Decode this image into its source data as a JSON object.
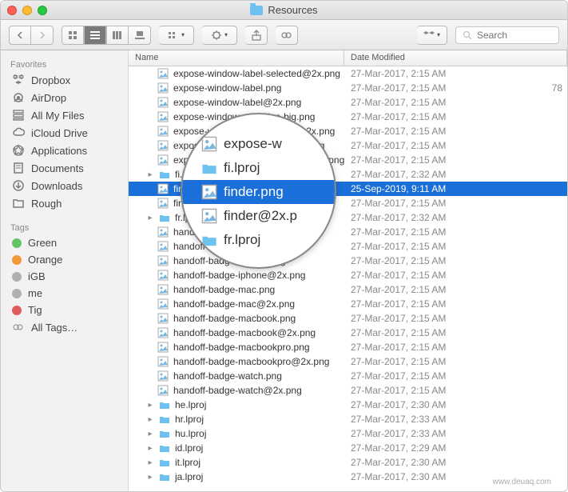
{
  "window": {
    "title": "Resources"
  },
  "toolbar": {
    "search_placeholder": "Search"
  },
  "sidebar": {
    "favorites_header": "Favorites",
    "favorites": [
      {
        "label": "Dropbox",
        "icon": "dropbox"
      },
      {
        "label": "AirDrop",
        "icon": "airdrop"
      },
      {
        "label": "All My Files",
        "icon": "allfiles"
      },
      {
        "label": "iCloud Drive",
        "icon": "icloud"
      },
      {
        "label": "Applications",
        "icon": "apps"
      },
      {
        "label": "Documents",
        "icon": "docs"
      },
      {
        "label": "Downloads",
        "icon": "downloads"
      },
      {
        "label": "Rough",
        "icon": "folder"
      }
    ],
    "tags_header": "Tags",
    "tags": [
      {
        "label": "Green",
        "color": "#64c466"
      },
      {
        "label": "Orange",
        "color": "#f09a37"
      },
      {
        "label": "iGB",
        "color": "#b0b0b0"
      },
      {
        "label": "me",
        "color": "#b0b0b0"
      },
      {
        "label": "Tig",
        "color": "#e05c5c"
      },
      {
        "label": "All Tags…",
        "color": ""
      }
    ]
  },
  "columns": {
    "name": "Name",
    "date": "Date Modified"
  },
  "files": [
    {
      "name": "expose-window-label-selected@2x.png",
      "date": "27-Mar-2017, 2:15 AM",
      "type": "img",
      "extra": ""
    },
    {
      "name": "expose-window-label.png",
      "date": "27-Mar-2017, 2:15 AM",
      "type": "img",
      "extra": "78"
    },
    {
      "name": "expose-window-label@2x.png",
      "date": "27-Mar-2017, 2:15 AM",
      "type": "img",
      "extra": ""
    },
    {
      "name": "expose-window-selection-big.png",
      "date": "27-Mar-2017, 2:15 AM",
      "type": "img",
      "extra": ""
    },
    {
      "name": "expose-window-selection-big@2x.png",
      "date": "27-Mar-2017, 2:15 AM",
      "type": "img",
      "extra": ""
    },
    {
      "name": "expose-window-selection-small.png",
      "date": "27-Mar-2017, 2:15 AM",
      "type": "img",
      "extra": ""
    },
    {
      "name": "expose-window-selection-small@2x.png",
      "date": "27-Mar-2017, 2:15 AM",
      "type": "img",
      "extra": ""
    },
    {
      "name": "fi.lproj",
      "date": "27-Mar-2017, 2:32 AM",
      "type": "folder",
      "extra": ""
    },
    {
      "name": "finder.png",
      "date": "25-Sep-2019, 9:11 AM",
      "type": "img",
      "extra": "",
      "selected": true
    },
    {
      "name": "finder@2x.png",
      "date": "27-Mar-2017, 2:15 AM",
      "type": "img",
      "extra": ""
    },
    {
      "name": "fr.lproj",
      "date": "27-Mar-2017, 2:32 AM",
      "type": "folder",
      "extra": ""
    },
    {
      "name": "handoff-badge-ipad.png",
      "date": "27-Mar-2017, 2:15 AM",
      "type": "img",
      "extra": ""
    },
    {
      "name": "handoff-badge-ipad@2x.png",
      "date": "27-Mar-2017, 2:15 AM",
      "type": "img",
      "extra": ""
    },
    {
      "name": "handoff-badge-iphone.png",
      "date": "27-Mar-2017, 2:15 AM",
      "type": "img",
      "extra": ""
    },
    {
      "name": "handoff-badge-iphone@2x.png",
      "date": "27-Mar-2017, 2:15 AM",
      "type": "img",
      "extra": ""
    },
    {
      "name": "handoff-badge-mac.png",
      "date": "27-Mar-2017, 2:15 AM",
      "type": "img",
      "extra": ""
    },
    {
      "name": "handoff-badge-mac@2x.png",
      "date": "27-Mar-2017, 2:15 AM",
      "type": "img",
      "extra": ""
    },
    {
      "name": "handoff-badge-macbook.png",
      "date": "27-Mar-2017, 2:15 AM",
      "type": "img",
      "extra": ""
    },
    {
      "name": "handoff-badge-macbook@2x.png",
      "date": "27-Mar-2017, 2:15 AM",
      "type": "img",
      "extra": ""
    },
    {
      "name": "handoff-badge-macbookpro.png",
      "date": "27-Mar-2017, 2:15 AM",
      "type": "img",
      "extra": ""
    },
    {
      "name": "handoff-badge-macbookpro@2x.png",
      "date": "27-Mar-2017, 2:15 AM",
      "type": "img",
      "extra": ""
    },
    {
      "name": "handoff-badge-watch.png",
      "date": "27-Mar-2017, 2:15 AM",
      "type": "img",
      "extra": ""
    },
    {
      "name": "handoff-badge-watch@2x.png",
      "date": "27-Mar-2017, 2:15 AM",
      "type": "img",
      "extra": ""
    },
    {
      "name": "he.lproj",
      "date": "27-Mar-2017, 2:30 AM",
      "type": "folder",
      "extra": ""
    },
    {
      "name": "hr.lproj",
      "date": "27-Mar-2017, 2:33 AM",
      "type": "folder",
      "extra": ""
    },
    {
      "name": "hu.lproj",
      "date": "27-Mar-2017, 2:33 AM",
      "type": "folder",
      "extra": ""
    },
    {
      "name": "id.lproj",
      "date": "27-Mar-2017, 2:29 AM",
      "type": "folder",
      "extra": ""
    },
    {
      "name": "it.lproj",
      "date": "27-Mar-2017, 2:30 AM",
      "type": "folder",
      "extra": ""
    },
    {
      "name": "ja.lproj",
      "date": "27-Mar-2017, 2:30 AM",
      "type": "folder",
      "extra": ""
    }
  ],
  "magnifier": [
    {
      "label": "expose-w",
      "type": "img"
    },
    {
      "label": "fi.lproj",
      "type": "folder"
    },
    {
      "label": "finder.png",
      "type": "img",
      "selected": true
    },
    {
      "label": "finder@2x.p",
      "type": "img"
    },
    {
      "label": "fr.lproj",
      "type": "folder"
    }
  ],
  "watermark": "www.deuaq.com"
}
